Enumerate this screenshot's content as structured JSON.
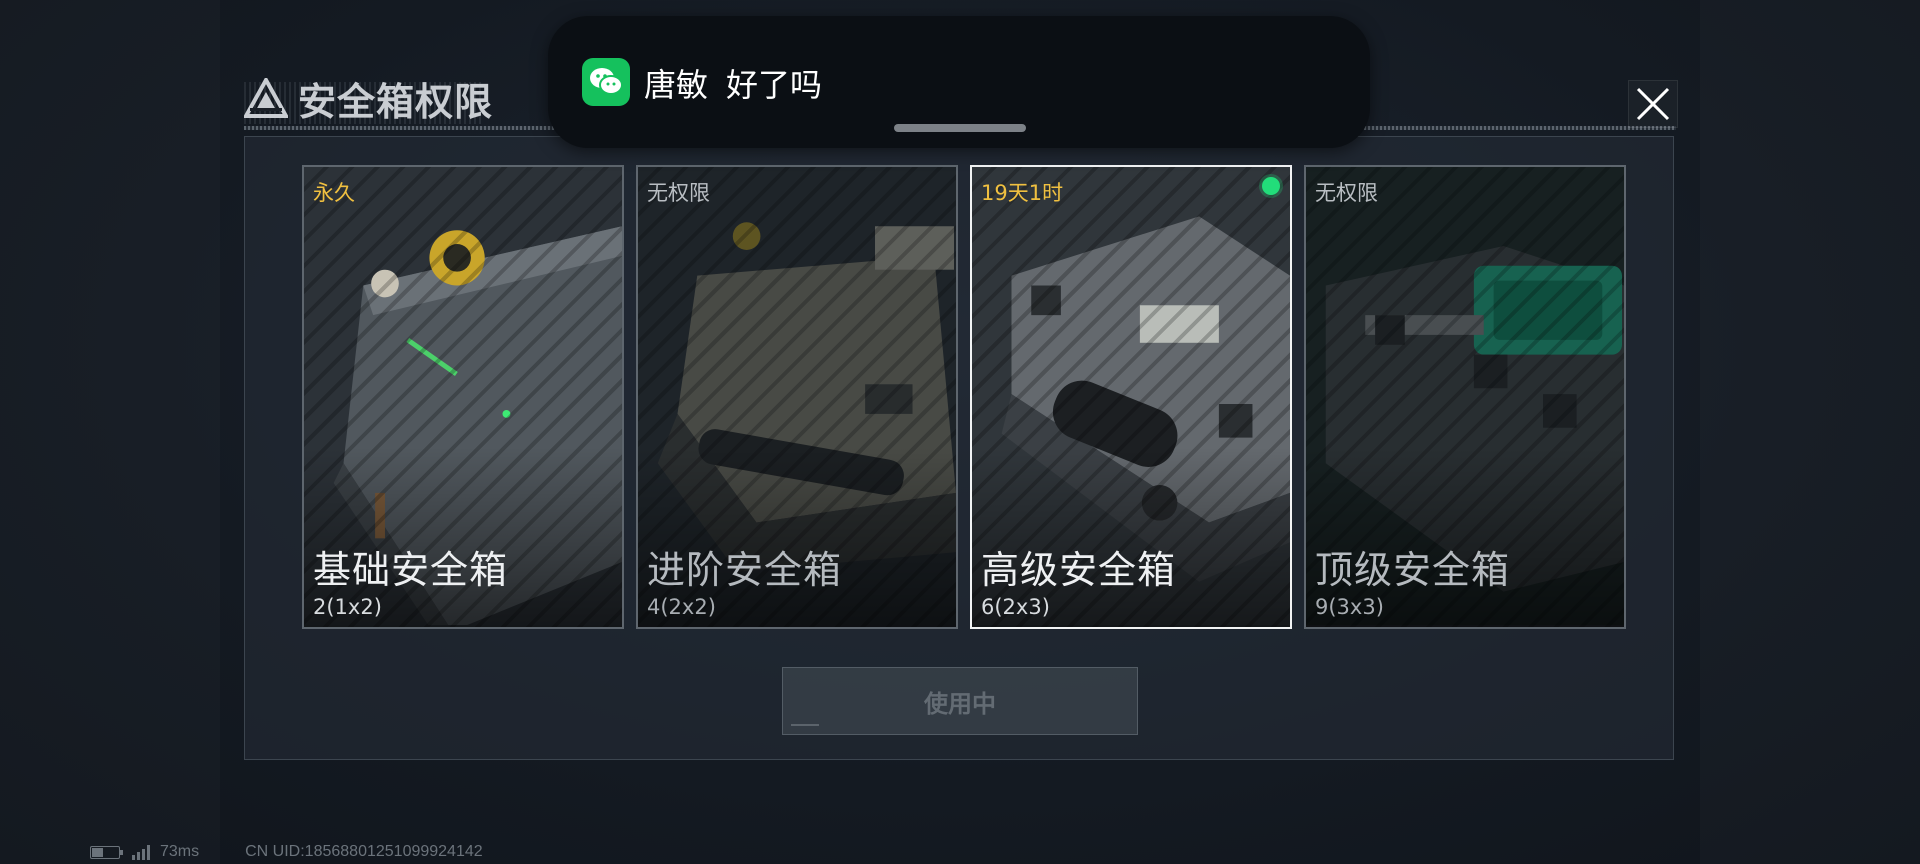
{
  "header": {
    "title": "安全箱权限",
    "logo_icon": "triangle-logo-icon",
    "close_icon": "close-icon"
  },
  "notification": {
    "app_icon": "wechat-icon",
    "sender": "唐敏",
    "message": "好了吗"
  },
  "cards": [
    {
      "tag": "永久",
      "name": "基础安全箱",
      "size": "2(1x2)",
      "selected": false,
      "active": false,
      "tag_color": "#f0c040"
    },
    {
      "tag": "无权限",
      "name": "进阶安全箱",
      "size": "4(2x2)",
      "selected": false,
      "active": false,
      "tag_color": "#b9bec3"
    },
    {
      "tag": "19天1时",
      "name": "高级安全箱",
      "size": "6(2x3)",
      "selected": true,
      "active": true,
      "tag_color": "#f0c040"
    },
    {
      "tag": "无权限",
      "name": "顶级安全箱",
      "size": "9(3x3)",
      "selected": false,
      "active": false,
      "tag_color": "#b9bec3"
    }
  ],
  "action": {
    "button_label": "使用中",
    "disabled": true
  },
  "status_bar": {
    "ping": "73ms",
    "uid": "CN UID:18568801251099924142",
    "battery_level": 0.4
  },
  "colors": {
    "accent_gold": "#f0c040",
    "active_green": "#22dd7a",
    "wechat_green": "#15c15d"
  }
}
